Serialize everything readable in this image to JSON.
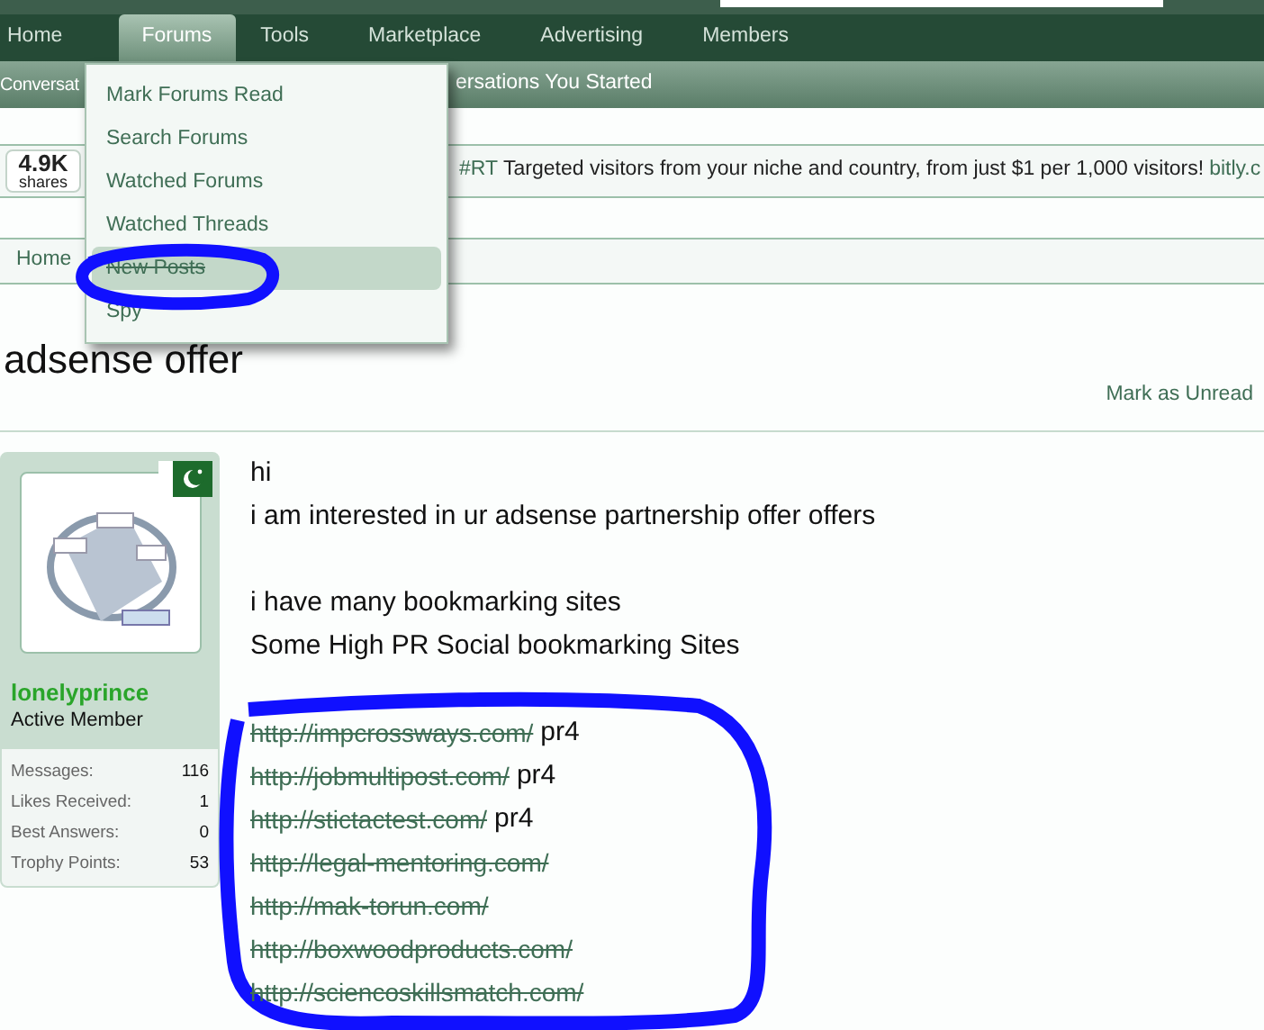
{
  "nav": {
    "tabs": [
      {
        "label": "Home",
        "selected": false
      },
      {
        "label": "Forums",
        "selected": true
      },
      {
        "label": "Tools",
        "selected": false
      },
      {
        "label": "Marketplace",
        "selected": false
      },
      {
        "label": "Advertising",
        "selected": false
      },
      {
        "label": "Members",
        "selected": false
      }
    ]
  },
  "subnav": {
    "items": [
      "Conversat",
      "ersations You Started"
    ]
  },
  "dropdown": {
    "items": [
      {
        "label": "Mark Forums Read",
        "selected": false,
        "struck": false
      },
      {
        "label": "Search Forums",
        "selected": false,
        "struck": false
      },
      {
        "label": "Watched Forums",
        "selected": false,
        "struck": false
      },
      {
        "label": "Watched Threads",
        "selected": false,
        "struck": false
      },
      {
        "label": "New Posts",
        "selected": true,
        "struck": true
      },
      {
        "label": "Spy",
        "selected": false,
        "struck": false
      }
    ]
  },
  "share_bar": {
    "count": "4.9K",
    "count_label": "shares",
    "tag": "#RT",
    "message": "Targeted visitors from your niche and country, from just $1 per 1,000 visitors!",
    "link": "bitly.c"
  },
  "breadcrumb": {
    "items": [
      "Home"
    ]
  },
  "thread": {
    "title": "adsense offer",
    "mark_unread": "Mark as Unread"
  },
  "user": {
    "name": "lonelyprince",
    "title": "Active Member",
    "stats": [
      {
        "label": "Messages:",
        "value": "116"
      },
      {
        "label": "Likes Received:",
        "value": "1"
      },
      {
        "label": "Best Answers:",
        "value": "0"
      },
      {
        "label": "Trophy Points:",
        "value": "53"
      }
    ]
  },
  "post": {
    "paragraphs": [
      [
        "hi",
        "i am interested in ur adsense partnership offer offers"
      ],
      [
        "i have many bookmarking sites",
        "Some High PR Social bookmarking Sites"
      ]
    ],
    "links": [
      {
        "url": "http://impcrossways.com/",
        "note": "pr4",
        "struck": true
      },
      {
        "url": "http://jobmultipost.com/",
        "note": "pr4",
        "struck": true
      },
      {
        "url": "http://stictactest.com/",
        "note": "pr4",
        "struck": true
      },
      {
        "url": "http://legal-mentoring.com/",
        "struck": true
      },
      {
        "url": "http://mak-torun.com/",
        "struck": true
      },
      {
        "url": "http://boxwoodproducts.com/",
        "struck": true
      },
      {
        "url": "http://sciencoskillsmatch.com/",
        "struck": true
      }
    ]
  }
}
